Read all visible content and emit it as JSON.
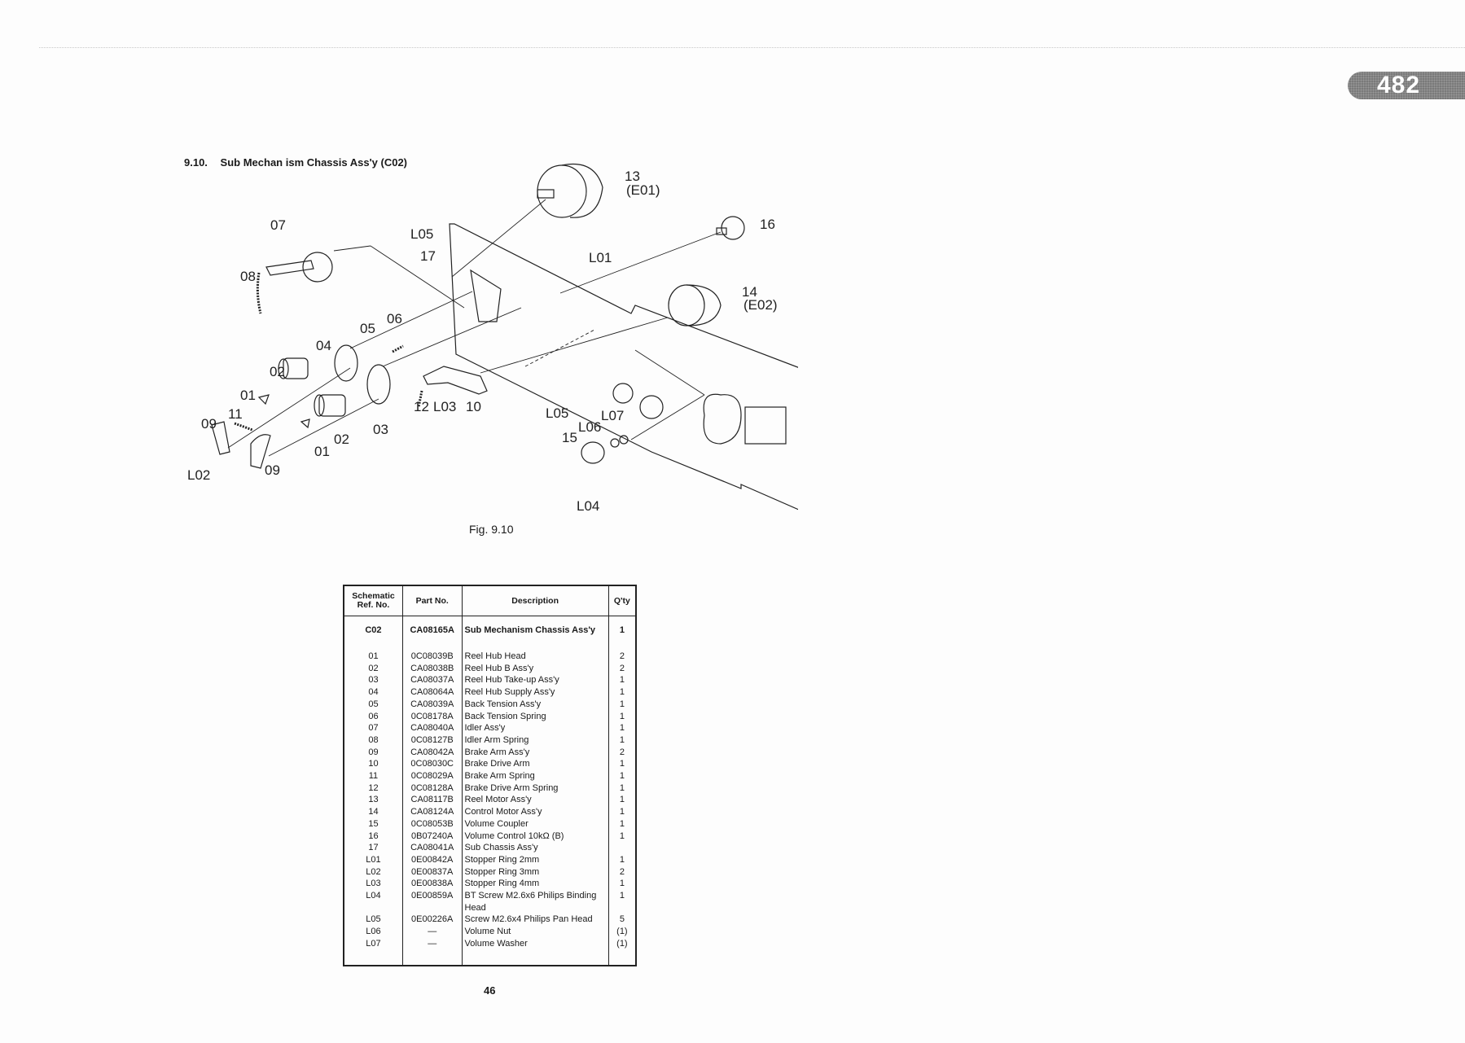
{
  "header": {
    "page_badge": "482"
  },
  "section": {
    "number": "9.10.",
    "title": "Sub Mechan ism Chassis Ass'y (C02)"
  },
  "diagram": {
    "caption": "Fig. 9.10",
    "callouts": [
      "07",
      "08",
      "L05",
      "17",
      "L01",
      "13",
      "(E01)",
      "16",
      "14",
      "(E02)",
      "05",
      "06",
      "04",
      "02",
      "01",
      "11",
      "09",
      "L02",
      "09",
      "01",
      "02",
      "03",
      "12",
      "L03",
      "10",
      "L05",
      "L07",
      "L06",
      "15",
      "L04"
    ]
  },
  "table": {
    "headers": {
      "ref": "Schematic Ref. No.",
      "part": "Part No.",
      "desc": "Description",
      "qty": "Q'ty"
    },
    "main_row": {
      "ref": "C02",
      "part": "CA08165A",
      "desc": "Sub Mechanism Chassis Ass'y",
      "qty": "1"
    },
    "rows": [
      {
        "ref": "01",
        "part": "0C08039B",
        "desc": "Reel Hub Head",
        "qty": "2"
      },
      {
        "ref": "02",
        "part": "CA08038B",
        "desc": "Reel Hub B Ass'y",
        "qty": "2"
      },
      {
        "ref": "03",
        "part": "CA08037A",
        "desc": "Reel Hub Take-up Ass'y",
        "qty": "1"
      },
      {
        "ref": "04",
        "part": "CA08064A",
        "desc": "Reel Hub Supply Ass'y",
        "qty": "1"
      },
      {
        "ref": "05",
        "part": "CA08039A",
        "desc": "Back Tension Ass'y",
        "qty": "1"
      },
      {
        "ref": "06",
        "part": "0C08178A",
        "desc": "Back Tension Spring",
        "qty": "1"
      },
      {
        "ref": "07",
        "part": "CA08040A",
        "desc": "Idler Ass'y",
        "qty": "1"
      },
      {
        "ref": "08",
        "part": "0C08127B",
        "desc": "Idler Arm Spring",
        "qty": "1"
      },
      {
        "ref": "09",
        "part": "CA08042A",
        "desc": "Brake Arm Ass'y",
        "qty": "2"
      },
      {
        "ref": "10",
        "part": "0C08030C",
        "desc": "Brake Drive Arm",
        "qty": "1"
      },
      {
        "ref": "11",
        "part": "0C08029A",
        "desc": "Brake Arm Spring",
        "qty": "1"
      },
      {
        "ref": "12",
        "part": "0C08128A",
        "desc": "Brake Drive Arm Spring",
        "qty": "1"
      },
      {
        "ref": "13",
        "part": "CA08117B",
        "desc": "Reel Motor Ass'y",
        "qty": "1"
      },
      {
        "ref": "14",
        "part": "CA08124A",
        "desc": "Control Motor Ass'y",
        "qty": "1"
      },
      {
        "ref": "15",
        "part": "0C08053B",
        "desc": "Volume Coupler",
        "qty": "1"
      },
      {
        "ref": "16",
        "part": "0B07240A",
        "desc": "Volume Control 10kΩ (B)",
        "qty": "1"
      },
      {
        "ref": "17",
        "part": "CA08041A",
        "desc": "Sub Chassis Ass'y",
        "qty": ""
      },
      {
        "ref": "L01",
        "part": "0E00842A",
        "desc": "Stopper Ring 2mm",
        "qty": "1"
      },
      {
        "ref": "L02",
        "part": "0E00837A",
        "desc": "Stopper Ring 3mm",
        "qty": "2"
      },
      {
        "ref": "L03",
        "part": "0E00838A",
        "desc": "Stopper Ring 4mm",
        "qty": "1"
      },
      {
        "ref": "L04",
        "part": "0E00859A",
        "desc": "BT Screw M2.6x6 Philips Binding Head",
        "qty": "1"
      },
      {
        "ref": "L05",
        "part": "0E00226A",
        "desc": "Screw M2.6x4 Philips Pan Head",
        "qty": "5"
      },
      {
        "ref": "L06",
        "part": "—",
        "desc": "Volume Nut",
        "qty": "(1)"
      },
      {
        "ref": "L07",
        "part": "—",
        "desc": "Volume Washer",
        "qty": "(1)"
      }
    ]
  },
  "footer": {
    "page_number": "46"
  }
}
